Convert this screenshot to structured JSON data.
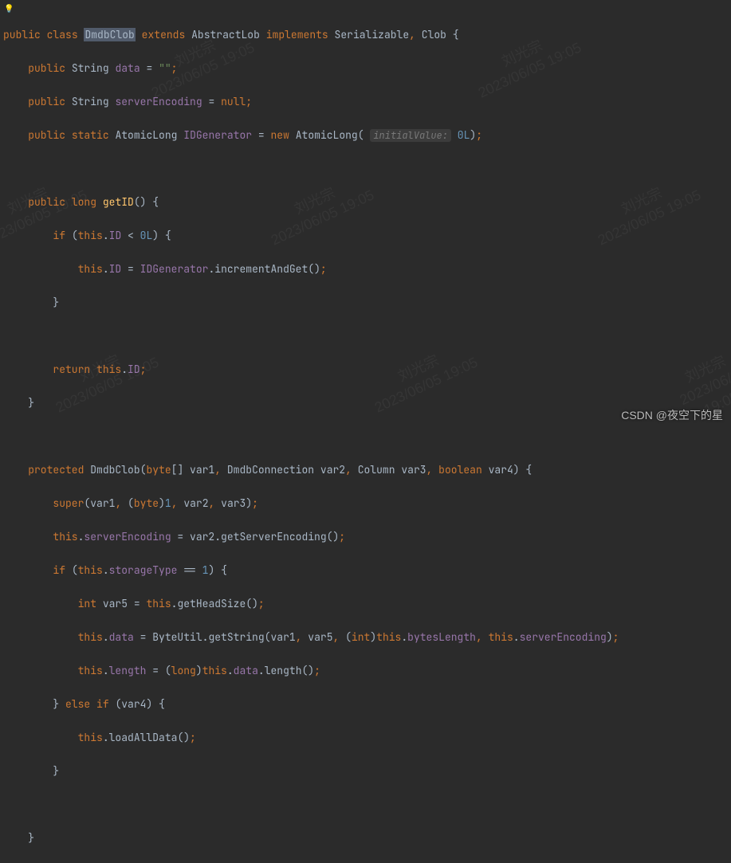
{
  "code": {
    "l1_public": "public",
    "l1_class": "class",
    "l1_classname": "DmdbClob",
    "l1_extends": "extends",
    "l1_parent": "AbstractLob",
    "l1_implements": "implements",
    "l1_iface1": "Serializable",
    "l1_iface2": "Clob",
    "l1_brace": " {",
    "l2": "    public String data = \"\";",
    "l2_public": "public",
    "l2_type": "String",
    "l2_field": "data",
    "l2_eq": " = ",
    "l2_val": "\"\"",
    "l3_public": "public",
    "l3_type": "String",
    "l3_field": "serverEncoding",
    "l3_eq": " = ",
    "l3_val": "null",
    "l4_public": "public",
    "l4_static": "static",
    "l4_type": "AtomicLong",
    "l4_field": "IDGenerator",
    "l4_eq": " = ",
    "l4_new": "new",
    "l4_ctor": "AtomicLong",
    "l4_hint": "initialValue:",
    "l4_val": "0L",
    "l6_public": "public",
    "l6_ret": "long",
    "l6_method": "getID",
    "l7_if": "if",
    "l7_this": "this",
    "l7_field": "ID",
    "l7_op": " < ",
    "l7_val": "0L",
    "l8_this": "this",
    "l8_field": "ID",
    "l8_eq": " = ",
    "l8_gen": "IDGenerator",
    "l8_method": "incrementAndGet",
    "l11_return": "return",
    "l11_this": "this",
    "l11_field": "ID",
    "l14_protected": "protected",
    "l14_ctor": "DmdbClob",
    "l14_byte": "byte",
    "l14_v1": "var1",
    "l14_t2": "DmdbConnection",
    "l14_v2": "var2",
    "l14_t3": "Column",
    "l14_v3": "var3",
    "l14_t4": "boolean",
    "l14_v4": "var4",
    "l15_super": "super",
    "l15_v1": "var1",
    "l15_byte": "byte",
    "l15_cast": "1",
    "l15_v2": "var2",
    "l15_v3": "var3",
    "l16_this": "this",
    "l16_f1": "serverEncoding",
    "l16_eq": " = ",
    "l16_v": "var2",
    "l16_m": "getServerEncoding",
    "l17_if": "if",
    "l17_this": "this",
    "l17_f": "storageType",
    "l17_eq": " == ",
    "l17_val": "1",
    "l18_int": "int",
    "l18_v": "var5",
    "l18_eq": " = ",
    "l18_this": "this",
    "l18_m": "getHeadSize",
    "l19_this1": "this",
    "l19_data": "data",
    "l19_eq": " = ",
    "l19_bu": "ByteUtil",
    "l19_m": "getString",
    "l19_v1": "var1",
    "l19_v5": "var5",
    "l19_int": "int",
    "l19_this2": "this",
    "l19_bl": "bytesLength",
    "l19_this3": "this",
    "l19_se": "serverEncoding",
    "l20_this1": "this",
    "l20_len": "length",
    "l20_eq": " = (",
    "l20_long": "long",
    "l20_this2": "this",
    "l20_data": "data",
    "l20_m": "length",
    "l21_else": "else",
    "l21_if": "if",
    "l21_v4": "var4",
    "l22_this": "this",
    "l22_m": "loadAllData"
  },
  "watermarks": [
    {
      "author": "刘光宗",
      "date": "2023/06/05 19:05"
    }
  ],
  "attribution": "CSDN @夜空下的星"
}
